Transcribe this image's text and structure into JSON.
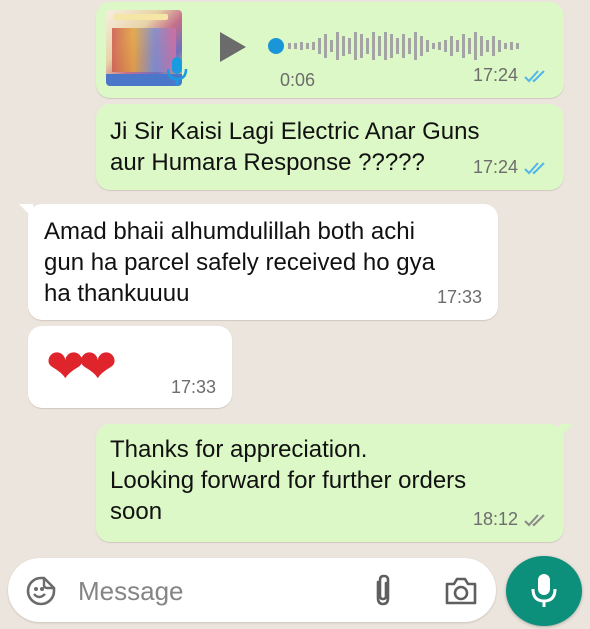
{
  "colors": {
    "chat_background": "#ece5dd",
    "outgoing_bubble": "#dcf8c6",
    "incoming_bubble": "#ffffff",
    "read_ticks": "#4fb6ec",
    "delivered_ticks": "#8a8a8a",
    "accent": "#0c8f7b"
  },
  "messages": {
    "voice": {
      "duration": "0:06",
      "time": "17:24",
      "status_icon": "double-check-read"
    },
    "m1": {
      "text": "Ji Sir Kaisi Lagi Electric Anar Guns\naur Humara Response ?????",
      "time": "17:24",
      "status_icon": "double-check-read"
    },
    "m2": {
      "text": "Amad bhaii alhumdulillah both achi\ngun ha parcel safely received ho gya\nha thankuuuu",
      "time": "17:33"
    },
    "m3": {
      "text": "❤❤",
      "time": "17:33"
    },
    "m4": {
      "text": "Thanks for appreciation.\nLooking forward for further orders\nsoon",
      "time": "18:12",
      "status_icon": "double-check-delivered"
    }
  },
  "input": {
    "placeholder": "Message",
    "icons": [
      "emoji-icon",
      "attach-icon",
      "camera-icon",
      "mic-icon"
    ]
  }
}
